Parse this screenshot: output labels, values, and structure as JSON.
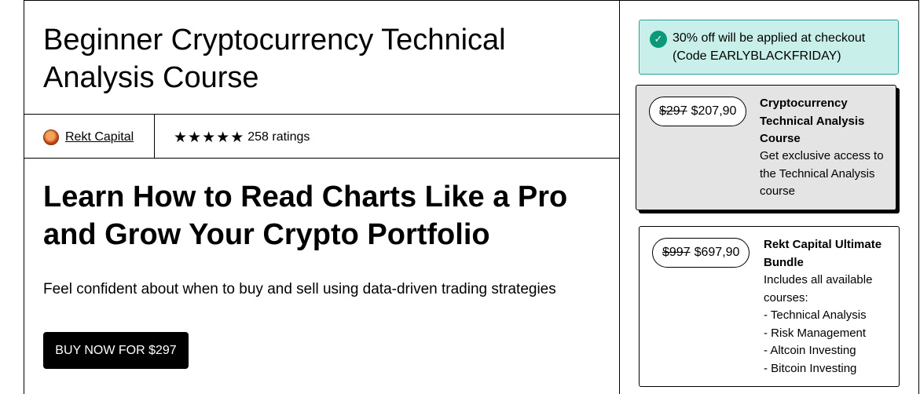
{
  "product": {
    "title": "Beginner Cryptocurrency Technical Analysis Course",
    "author": "Rekt Capital",
    "ratings_count_text": "258 ratings",
    "stars": 5,
    "headline": "Learn How to Read Charts Like a Pro and Grow Your Crypto Portfolio",
    "description": "Feel confident about when to buy and sell using data-driven trading strategies",
    "buy_label": "BUY NOW FOR $297"
  },
  "promo": {
    "text": "30% off will be applied at checkout (Code EARLYBLACKFRIDAY)",
    "accent": "#0a9a7a",
    "background": "#c8efe9"
  },
  "offers": [
    {
      "old_price": "$297",
      "new_price": "$207,90",
      "name": "Cryptocurrency Technical Analysis Course",
      "description": "Get exclusive access to the Technical Analysis course",
      "selected": true
    },
    {
      "old_price": "$997",
      "new_price": "$697,90",
      "name": "Rekt Capital Ultimate Bundle",
      "description_lines": [
        "Includes all available courses:",
        "- Technical Analysis",
        "- Risk Management",
        "- Altcoin Investing",
        "- Bitcoin Investing"
      ],
      "selected": false
    }
  ]
}
